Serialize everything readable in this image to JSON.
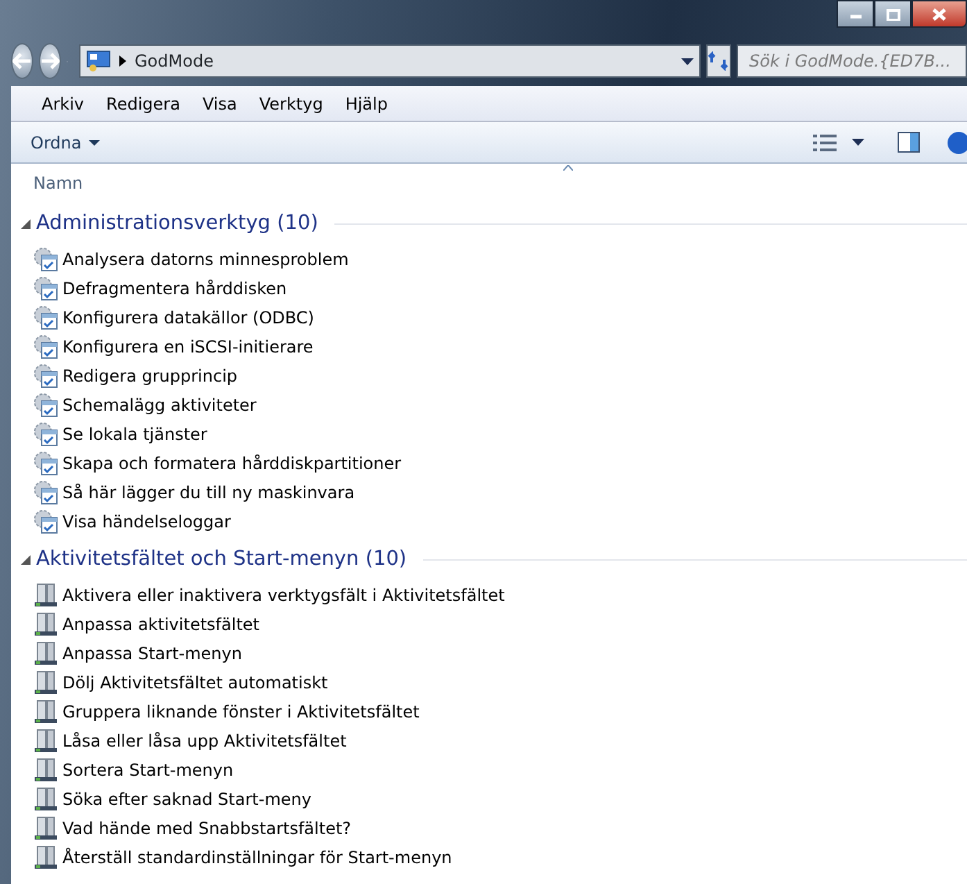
{
  "address_bar": {
    "path": "GodMode",
    "search_placeholder": "Sök i GodMode.{ED7B..."
  },
  "menu": [
    "Arkiv",
    "Redigera",
    "Visa",
    "Verktyg",
    "Hjälp"
  ],
  "toolbar": {
    "organize": "Ordna"
  },
  "column_header": "Namn",
  "groups": [
    {
      "title": "Administrationsverktyg (10)",
      "kind": "admin",
      "expanded": true,
      "items": [
        "Analysera datorns minnesproblem",
        "Defragmentera hårddisken",
        "Konfigurera datakällor (ODBC)",
        "Konfigurera en iSCSI-initierare",
        "Redigera grupprincip",
        "Schemalägg aktiviteter",
        "Se lokala tjänster",
        "Skapa och formatera hårddiskpartitioner",
        "Så här lägger du till ny maskinvara",
        "Visa händelseloggar"
      ]
    },
    {
      "title": "Aktivitetsfältet och Start-menyn (10)",
      "kind": "taskbar",
      "expanded": true,
      "items": [
        "Aktivera eller inaktivera verktygsfält i Aktivitetsfältet",
        "Anpassa aktivitetsfältet",
        "Anpassa Start-menyn",
        "Dölj Aktivitetsfältet automatiskt",
        "Gruppera liknande fönster i Aktivitetsfältet",
        "Låsa eller låsa upp Aktivitetsfältet",
        "Sortera Start-menyn",
        "Söka efter saknad Start-meny",
        "Vad hände med Snabbstartsfältet?",
        "Återställ standardinställningar för Start-menyn"
      ]
    }
  ]
}
